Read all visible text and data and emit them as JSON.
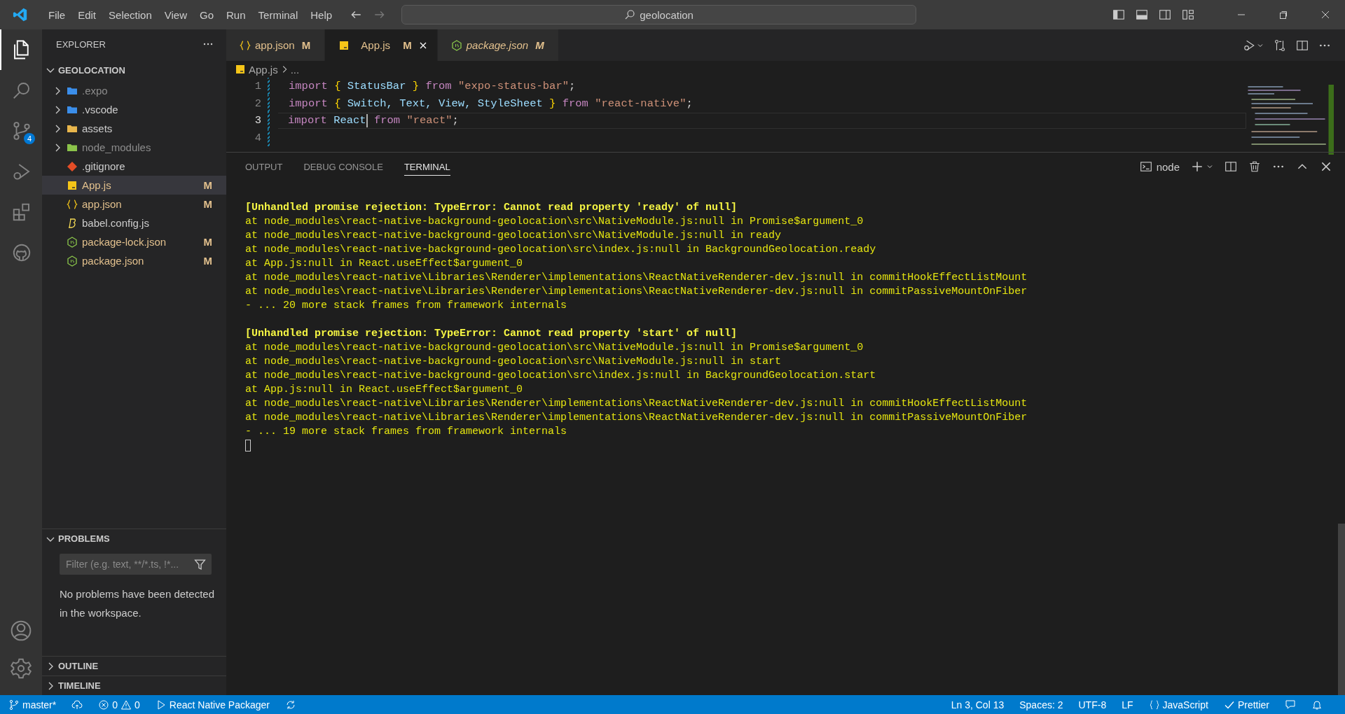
{
  "menu": [
    "File",
    "Edit",
    "Selection",
    "View",
    "Go",
    "Run",
    "Terminal",
    "Help"
  ],
  "search": {
    "value": "geolocation"
  },
  "activity": [
    {
      "kind": "files",
      "selected": true
    },
    {
      "kind": "search",
      "selected": false
    },
    {
      "kind": "scm",
      "selected": false,
      "badge": "4"
    },
    {
      "kind": "debug",
      "selected": false
    },
    {
      "kind": "extensions",
      "selected": false
    },
    {
      "kind": "github",
      "selected": false
    }
  ],
  "sidebar": {
    "title": "EXPLORER",
    "folder": {
      "name": "GEOLOCATION",
      "expanded": true,
      "children": [
        {
          "name": ".expo",
          "kind": "folder",
          "color": "#3b8eea",
          "ignored": true,
          "selected": false,
          "expanded": false
        },
        {
          "name": ".vscode",
          "kind": "folder",
          "color": "#3b8eea",
          "ignored": false,
          "selected": false,
          "expanded": false
        },
        {
          "name": "assets",
          "kind": "folder",
          "color": "#e8b64c",
          "ignored": false,
          "selected": false,
          "expanded": false
        },
        {
          "name": "node_modules",
          "kind": "folder",
          "color": "#8bc34a",
          "ignored": true,
          "selected": false,
          "expanded": false
        },
        {
          "name": ".gitignore",
          "kind": "git",
          "ignored": false,
          "selected": false
        },
        {
          "name": "App.js",
          "kind": "js",
          "ignored": false,
          "selected": true,
          "status": "M"
        },
        {
          "name": "app.json",
          "kind": "json",
          "ignored": false,
          "selected": false,
          "status": "M"
        },
        {
          "name": "babel.config.js",
          "kind": "babel",
          "ignored": false,
          "selected": false
        },
        {
          "name": "package-lock.json",
          "kind": "node",
          "ignored": false,
          "selected": false,
          "status": "M"
        },
        {
          "name": "package.json",
          "kind": "node",
          "ignored": false,
          "selected": false,
          "status": "M"
        }
      ]
    }
  },
  "problems": {
    "title": "PROBLEMS",
    "expanded": true,
    "placeholder": "Filter (e.g. text, **/*.ts, !*...",
    "message": "No problems have been detected in the workspace."
  },
  "collapsed_sections": [
    "OUTLINE",
    "TIMELINE"
  ],
  "tabs": [
    {
      "label": "app.json",
      "kind": "json",
      "status": "M",
      "selected": false,
      "preview": false
    },
    {
      "label": "App.js",
      "kind": "js",
      "status": "M",
      "selected": true,
      "preview": false
    },
    {
      "label": "package.json",
      "kind": "node",
      "status": "M",
      "selected": false,
      "preview": true
    }
  ],
  "breadcrumb": [
    "App.js",
    "..."
  ],
  "code": [
    {
      "number": "1",
      "current": false,
      "tokens": [
        {
          "text": "import ",
          "kind": "keyword"
        },
        {
          "text": "{",
          "kind": "brace"
        },
        {
          "text": " StatusBar ",
          "kind": "variable"
        },
        {
          "text": "}",
          "kind": "brace"
        },
        {
          "text": " from ",
          "kind": "keyword"
        },
        {
          "text": "\"expo-status-bar\"",
          "kind": "string"
        },
        {
          "text": ";",
          "kind": "plain"
        }
      ]
    },
    {
      "number": "2",
      "current": false,
      "tokens": [
        {
          "text": "import ",
          "kind": "keyword"
        },
        {
          "text": "{",
          "kind": "brace"
        },
        {
          "text": " Switch, Text, View, StyleSheet ",
          "kind": "variable"
        },
        {
          "text": "}",
          "kind": "brace"
        },
        {
          "text": " from ",
          "kind": "keyword"
        },
        {
          "text": "\"react-native\"",
          "kind": "string"
        },
        {
          "text": ";",
          "kind": "plain"
        }
      ]
    },
    {
      "number": "3",
      "current": true,
      "tokens": [
        {
          "text": "import ",
          "kind": "keyword"
        },
        {
          "text": "React",
          "kind": "variable",
          "caret": true
        },
        {
          "text": " from ",
          "kind": "keyword"
        },
        {
          "text": "\"react\"",
          "kind": "string"
        },
        {
          "text": ";",
          "kind": "plain"
        }
      ]
    },
    {
      "number": "4",
      "current": false
    }
  ],
  "panel": {
    "tabs": [
      {
        "label": "OUTPUT",
        "selected": false
      },
      {
        "label": "DEBUG CONSOLE",
        "selected": false
      },
      {
        "label": "TERMINAL",
        "selected": true
      }
    ],
    "shell": "node",
    "cursor": true,
    "lines": [
      {
        "kind": "header",
        "text": "[Unhandled promise rejection: TypeError: Cannot read property 'ready' of null]"
      },
      {
        "kind": "trace",
        "text": "at node_modules\\react-native-background-geolocation\\src\\NativeModule.js:null in Promise$argument_0"
      },
      {
        "kind": "trace",
        "text": "at node_modules\\react-native-background-geolocation\\src\\NativeModule.js:null in ready"
      },
      {
        "kind": "trace",
        "text": "at node_modules\\react-native-background-geolocation\\src\\index.js:null in BackgroundGeolocation.ready"
      },
      {
        "kind": "trace",
        "text": "at App.js:null in React.useEffect$argument_0"
      },
      {
        "kind": "trace",
        "text": "at node_modules\\react-native\\Libraries\\Renderer\\implementations\\ReactNativeRenderer-dev.js:null in commitHookEffectListMount"
      },
      {
        "kind": "trace",
        "text": "at node_modules\\react-native\\Libraries\\Renderer\\implementations\\ReactNativeRenderer-dev.js:null in commitPassiveMountOnFiber"
      },
      {
        "kind": "trace",
        "text": "- ... 20 more stack frames from framework internals"
      },
      {
        "kind": "blank"
      },
      {
        "kind": "header",
        "text": "[Unhandled promise rejection: TypeError: Cannot read property 'start' of null]"
      },
      {
        "kind": "trace",
        "text": "at node_modules\\react-native-background-geolocation\\src\\NativeModule.js:null in Promise$argument_0"
      },
      {
        "kind": "trace",
        "text": "at node_modules\\react-native-background-geolocation\\src\\NativeModule.js:null in start"
      },
      {
        "kind": "trace",
        "text": "at node_modules\\react-native-background-geolocation\\src\\index.js:null in BackgroundGeolocation.start"
      },
      {
        "kind": "trace",
        "text": "at App.js:null in React.useEffect$argument_0"
      },
      {
        "kind": "trace",
        "text": "at node_modules\\react-native\\Libraries\\Renderer\\implementations\\ReactNativeRenderer-dev.js:null in commitHookEffectListMount"
      },
      {
        "kind": "trace",
        "text": "at node_modules\\react-native\\Libraries\\Renderer\\implementations\\ReactNativeRenderer-dev.js:null in commitPassiveMountOnFiber"
      },
      {
        "kind": "trace",
        "text": "- ... 19 more stack frames from framework internals"
      }
    ]
  },
  "status_left": [
    {
      "kind": "branch",
      "text": "master*"
    },
    {
      "kind": "publish"
    },
    {
      "kind": "problems",
      "errors": "0",
      "warnings": "0"
    },
    {
      "kind": "play",
      "text": "React Native Packager"
    },
    {
      "kind": "refresh"
    }
  ],
  "status_right": [
    {
      "kind": "text",
      "text": "Ln 3, Col 13"
    },
    {
      "kind": "text",
      "text": "Spaces: 2"
    },
    {
      "kind": "text",
      "text": "UTF-8"
    },
    {
      "kind": "text",
      "text": "LF"
    },
    {
      "kind": "language",
      "text": "JavaScript"
    },
    {
      "kind": "check",
      "text": "Prettier"
    },
    {
      "kind": "feedback"
    },
    {
      "kind": "bell"
    }
  ]
}
